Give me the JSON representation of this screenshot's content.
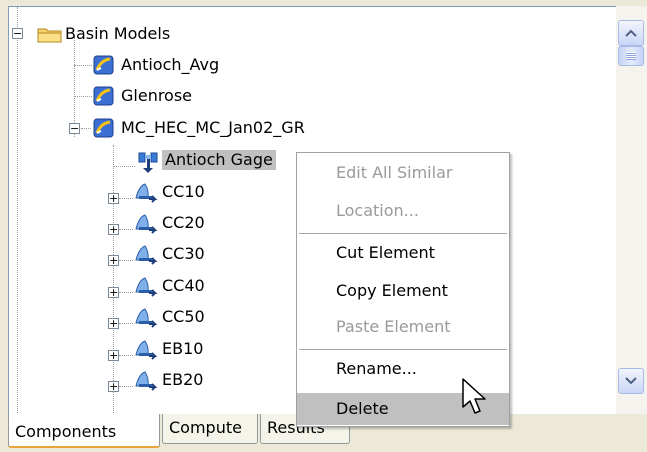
{
  "tree": {
    "root": {
      "label": "Basin Models",
      "icon": "folder-icon",
      "expanded": true
    },
    "children": [
      {
        "label": "Antioch_Avg",
        "icon": "basin-model-icon"
      },
      {
        "label": "Glenrose",
        "icon": "basin-model-icon"
      },
      {
        "label": "MC_HEC_MC_Jan02_GR",
        "icon": "basin-model-icon",
        "expanded": true,
        "children": [
          {
            "label": "Antioch Gage",
            "icon": "gage-icon",
            "selected": true
          },
          {
            "label": "CC10",
            "icon": "subbasin-icon"
          },
          {
            "label": "CC20",
            "icon": "subbasin-icon"
          },
          {
            "label": "CC30",
            "icon": "subbasin-icon"
          },
          {
            "label": "CC40",
            "icon": "subbasin-icon"
          },
          {
            "label": "CC50",
            "icon": "subbasin-icon"
          },
          {
            "label": "EB10",
            "icon": "subbasin-icon"
          },
          {
            "label": "EB20",
            "icon": "subbasin-icon"
          }
        ]
      }
    ]
  },
  "context_menu": {
    "items": [
      {
        "label": "Edit All Similar",
        "enabled": false
      },
      {
        "label": "Location...",
        "enabled": false
      },
      {
        "label": "Cut Element",
        "enabled": true
      },
      {
        "label": "Copy Element",
        "enabled": true
      },
      {
        "label": "Paste Element",
        "enabled": false
      },
      {
        "label": "Rename...",
        "enabled": true
      },
      {
        "label": "Delete",
        "enabled": true,
        "highlighted": true
      }
    ]
  },
  "tabs": [
    {
      "label": "Components",
      "active": true
    },
    {
      "label": "Compute",
      "active": false
    },
    {
      "label": "Results",
      "active": false
    }
  ],
  "colors": {
    "selection": "#c0c0c0",
    "menu_highlight": "#c0c0c0",
    "disabled_text": "#9a9a9a",
    "active_tab_accent": "#e4a43a"
  }
}
